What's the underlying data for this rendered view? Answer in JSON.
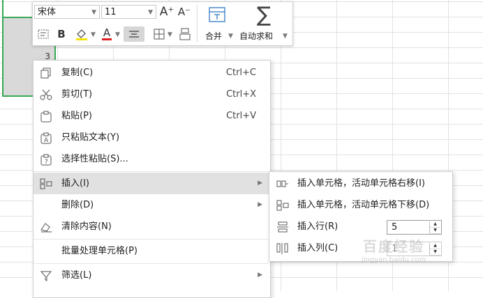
{
  "sheet": {
    "row_label": "3"
  },
  "mini_toolbar": {
    "font_name": "宋体",
    "font_size": "11",
    "increase_font_label": "A⁺",
    "decrease_font_label": "A⁻",
    "bold_label": "B",
    "font_color_label": "A",
    "merge_label": "合并",
    "autosum_label": "自动求和",
    "autosum_symbol": "∑"
  },
  "context_menu": {
    "items": [
      {
        "label": "复制(C)",
        "shortcut": "Ctrl+C",
        "icon": "copy-icon"
      },
      {
        "label": "剪切(T)",
        "shortcut": "Ctrl+X",
        "icon": "scissors-icon"
      },
      {
        "label": "粘贴(P)",
        "shortcut": "Ctrl+V",
        "icon": "paste-icon"
      },
      {
        "label": "只粘贴文本(Y)",
        "icon": "paste-text-icon"
      },
      {
        "label": "选择性粘贴(S)...",
        "icon": "paste-special-icon"
      },
      {
        "label": "插入(I)",
        "icon": "insert-icon",
        "highlighted": true
      },
      {
        "label": "删除(D)"
      },
      {
        "label": "清除内容(N)",
        "icon": "clear-icon"
      },
      {
        "label": "批量处理单元格(P)"
      },
      {
        "label": "筛选(L)",
        "icon": "filter-icon"
      }
    ]
  },
  "insert_submenu": {
    "items": [
      {
        "label": "插入单元格，活动单元格右移(I)",
        "icon": "insert-cell-right-icon"
      },
      {
        "label": "插入单元格，活动单元格下移(D)",
        "icon": "insert-cell-down-icon"
      },
      {
        "label": "插入行(R)",
        "icon": "insert-row-icon",
        "value": "5"
      },
      {
        "label": "插入列(C)",
        "icon": "insert-column-icon",
        "value": "1"
      }
    ]
  },
  "watermark": {
    "text": "百度经验",
    "subtext": "jingyan.baidu.com"
  },
  "colors": {
    "selection_border": "#36a853",
    "menu_highlight": "#e1e1e1",
    "font_color_bar": "#e02020",
    "fill_color_bar": "#f3e400"
  }
}
